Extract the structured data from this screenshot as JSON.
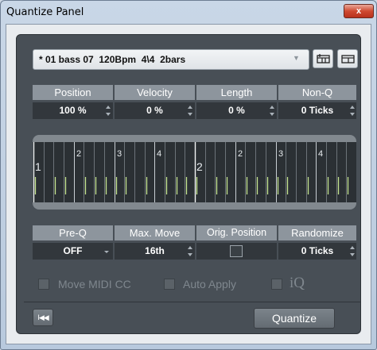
{
  "window": {
    "title": "Quantize Panel",
    "close_glyph": "x"
  },
  "preset": {
    "value": "* 01 bass 07  120Bpm  4\\4  2bars",
    "arrow_icon": "dropdown-arrow"
  },
  "row1": {
    "headers": [
      "Position",
      "Velocity",
      "Length",
      "Non-Q"
    ],
    "values": [
      "100 %",
      "0 %",
      "0 %",
      "0 Ticks"
    ]
  },
  "grid": {
    "bar_labels": [
      "1",
      "2"
    ],
    "beat_labels": [
      "2",
      "3",
      "4",
      "2",
      "3",
      "4"
    ],
    "hit_color": "#c6e68f"
  },
  "row2": {
    "headers": [
      "Pre-Q",
      "Max. Move",
      "Orig. Position",
      "Randomize"
    ],
    "values": [
      "OFF",
      "16th",
      "",
      "0 Ticks"
    ]
  },
  "options": {
    "move_midi_cc": "Move MIDI CC",
    "auto_apply": "Auto Apply",
    "iq": "iQ"
  },
  "buttons": {
    "quantize": "Quantize",
    "reset_glyph": "I◀◀"
  }
}
